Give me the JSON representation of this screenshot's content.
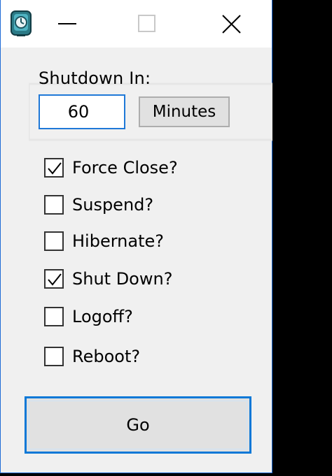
{
  "window": {
    "icon": "power-timer-app-icon",
    "controls": {
      "minimize": "minimize-icon",
      "maximize": "maximize-icon",
      "close": "close-icon"
    },
    "accent_color": "#1e6bd6"
  },
  "shutdown": {
    "label": "Shutdown In:",
    "value": "60",
    "unit_button": "Minutes"
  },
  "options": [
    {
      "label": "Force Close?",
      "checked": true
    },
    {
      "label": "Suspend?",
      "checked": false
    },
    {
      "label": "Hibernate?",
      "checked": false
    },
    {
      "label": "Shut Down?",
      "checked": true
    },
    {
      "label": "Logoff?",
      "checked": false
    },
    {
      "label": "Reboot?",
      "checked": false
    }
  ],
  "go_button": {
    "label": "Go",
    "border_color": "#0a78d7"
  }
}
